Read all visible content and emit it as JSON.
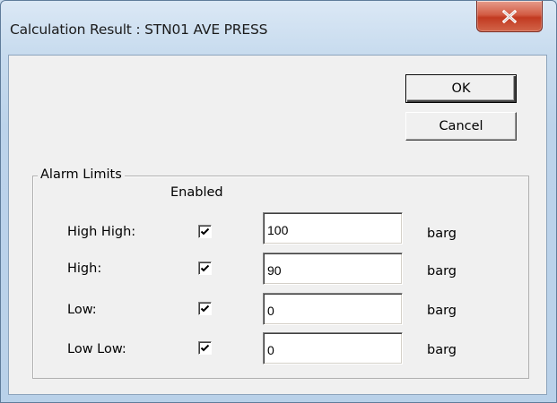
{
  "window": {
    "title": "Calculation Result : STN01 AVE PRESS"
  },
  "buttons": {
    "ok_label": "OK",
    "cancel_label": "Cancel"
  },
  "alarm_limits": {
    "group_label": "Alarm Limits",
    "enabled_header": "Enabled",
    "rows": [
      {
        "label": "High High:",
        "enabled": true,
        "value": "100",
        "unit": "barg"
      },
      {
        "label": "High:",
        "enabled": true,
        "value": "90",
        "unit": "barg"
      },
      {
        "label": "Low:",
        "enabled": true,
        "value": "0",
        "unit": "barg"
      },
      {
        "label": "Low Low:",
        "enabled": true,
        "value": "0",
        "unit": "barg"
      }
    ]
  },
  "icons": {
    "close": "close-icon",
    "check": "checkmark-icon"
  },
  "colors": {
    "close_button": "#c9432a",
    "dialog_bg": "#f0f0f0",
    "frame": "#c7dbee"
  }
}
